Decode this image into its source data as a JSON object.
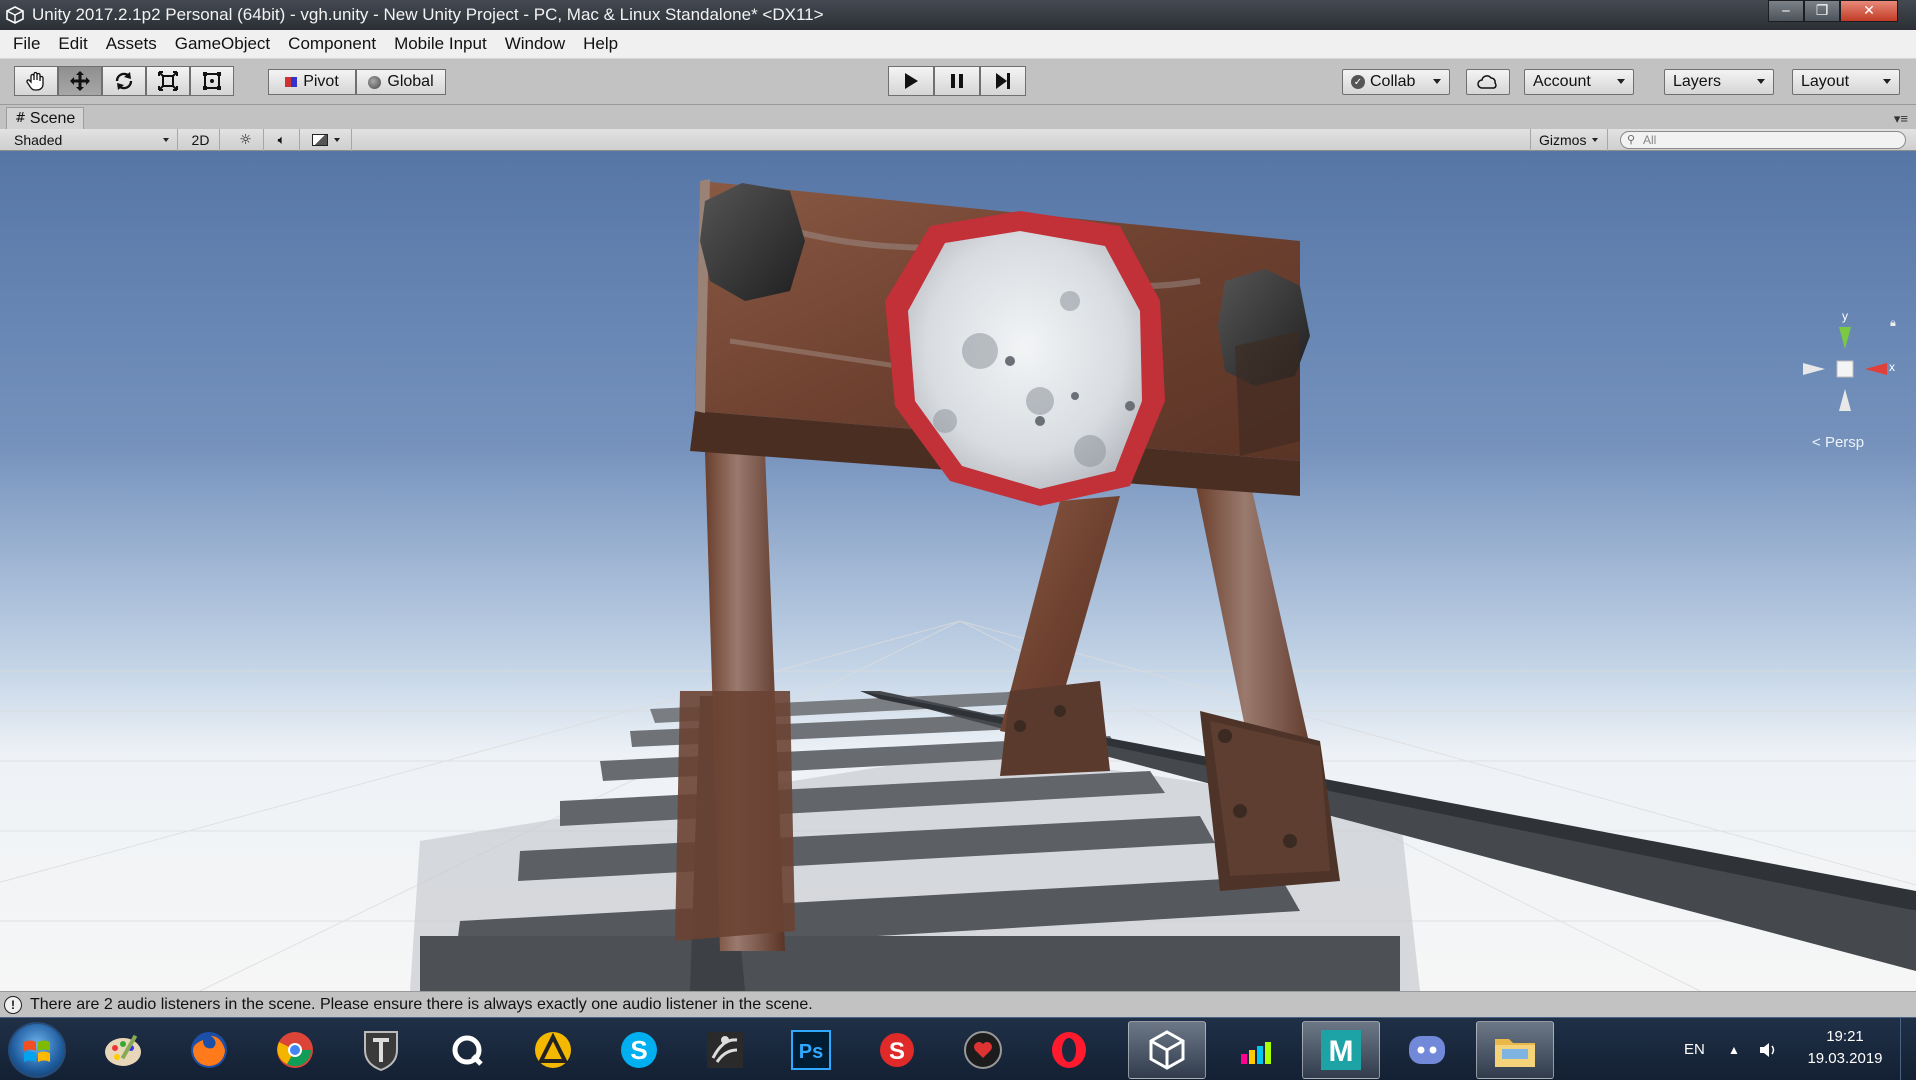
{
  "window": {
    "title": "Unity 2017.2.1p2 Personal (64bit) - vgh.unity - New Unity Project - PC, Mac & Linux Standalone* <DX11>",
    "minimize": "‒",
    "maximize": "❐",
    "close": "✕"
  },
  "menu": [
    "File",
    "Edit",
    "Assets",
    "GameObject",
    "Component",
    "Mobile Input",
    "Window",
    "Help"
  ],
  "toolbar": {
    "pivot_label": "Pivot",
    "global_label": "Global",
    "collab_label": "Collab",
    "account_label": "Account",
    "layers_label": "Layers",
    "layout_label": "Layout"
  },
  "scene_panel": {
    "tab_label": "Scene",
    "shading_mode": "Shaded",
    "mode_2d": "2D",
    "gizmos_label": "Gizmos",
    "search_placeholder": "All",
    "persp_label": "Persp",
    "axis_y": "y",
    "axis_x": "x"
  },
  "status": {
    "message": "There are 2 audio listeners in the scene. Please ensure there is always exactly one audio listener in the scene."
  },
  "taskbar": {
    "language": "EN",
    "time": "19:21",
    "date": "19.03.2019",
    "apps": [
      "paint-icon",
      "firefox-icon",
      "chrome-icon",
      "world-of-tanks-icon",
      "quixel-icon",
      "archicad-icon",
      "skype-icon",
      "zbrush-icon",
      "photoshop-icon",
      "substance-painter-icon",
      "game-icon",
      "opera-icon",
      "unity-icon",
      "deezer-icon",
      "maya-icon",
      "discord-icon",
      "explorer-icon"
    ]
  },
  "colors": {
    "sky_top": "#5a79a8",
    "sky_horizon": "#dde8f2",
    "ground": "#f4f4f4",
    "rust": "#7a4a34",
    "sign_red": "#c8303a",
    "track_grey": "#5e6166",
    "taskbar": "#1a2a40"
  }
}
